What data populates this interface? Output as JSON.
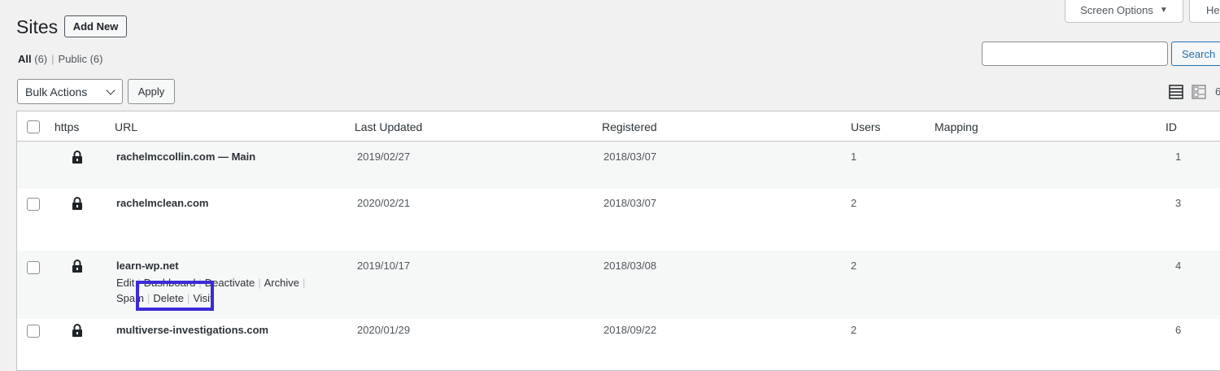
{
  "page": {
    "title": "Sites",
    "add_new": "Add New"
  },
  "tabs": {
    "screen_options": "Screen Options",
    "help": "Hel"
  },
  "filters": {
    "all_label": "All",
    "all_count": "(6)",
    "public_label": "Public",
    "public_count": "(6)"
  },
  "search": {
    "value": "",
    "button": "Search"
  },
  "bulk": {
    "selected": "Bulk Actions",
    "apply": "Apply"
  },
  "pagination": {
    "count_fragment": "6"
  },
  "table": {
    "columns": {
      "https": "https",
      "url": "URL",
      "last_updated": "Last Updated",
      "registered": "Registered",
      "users": "Users",
      "mapping": "Mapping",
      "id": "ID"
    },
    "rows": [
      {
        "url": "rachelmccollin.com — Main",
        "last_updated": "2019/02/27",
        "registered": "2018/03/07",
        "users": "1",
        "mapping": "",
        "id": "1"
      },
      {
        "url": "rachelmclean.com",
        "last_updated": "2020/02/21",
        "registered": "2018/03/07",
        "users": "2",
        "mapping": "",
        "id": "3"
      },
      {
        "url": "learn-wp.net",
        "last_updated": "2019/10/17",
        "registered": "2018/03/08",
        "users": "2",
        "mapping": "",
        "id": "4",
        "actions": {
          "edit": "Edit",
          "dashboard": "Dashboard",
          "deactivate": "Deactivate",
          "archive": "Archive",
          "spam": "Spam",
          "delete": "Delete",
          "visit": "Visit"
        }
      },
      {
        "url": "multiverse-investigations.com",
        "last_updated": "2020/01/29",
        "registered": "2018/09/22",
        "users": "2",
        "mapping": "",
        "id": "6"
      }
    ]
  },
  "colors": {
    "accent": "#2271b1",
    "highlight": "#3b2bd8"
  }
}
